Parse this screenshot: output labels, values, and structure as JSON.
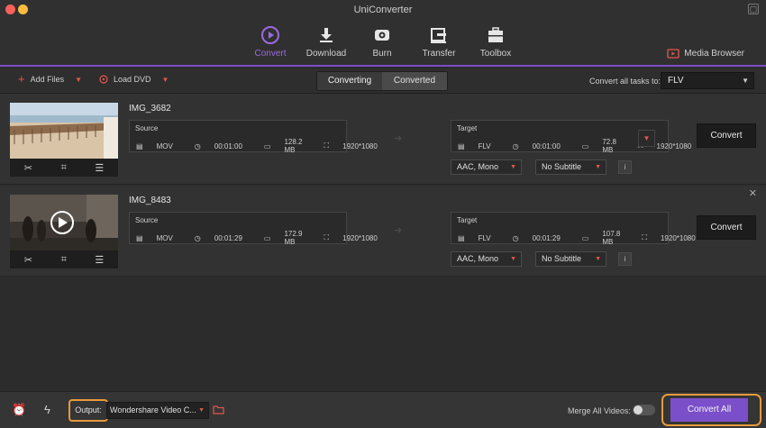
{
  "window": {
    "title": "UniConverter"
  },
  "nav": {
    "items": [
      {
        "label": "Convert",
        "icon": "convert-play-icon",
        "active": true
      },
      {
        "label": "Download",
        "icon": "download-icon",
        "active": false
      },
      {
        "label": "Burn",
        "icon": "disc-icon",
        "active": false
      },
      {
        "label": "Transfer",
        "icon": "transfer-icon",
        "active": false
      },
      {
        "label": "Toolbox",
        "icon": "toolbox-icon",
        "active": false
      }
    ],
    "media_browser": "Media Browser"
  },
  "toolbar": {
    "add_files": "Add Files",
    "load_dvd": "Load DVD",
    "tabs": [
      "Converting",
      "Converted"
    ],
    "active_tab": "Converting",
    "convert_all_label": "Convert all tasks to:",
    "convert_all_format": "FLV"
  },
  "tasks": [
    {
      "name": "IMG_3682",
      "source": {
        "caption": "Source",
        "format": "MOV",
        "duration": "00:01:00",
        "size": "128.2 MB",
        "resolution": "1920*1080"
      },
      "target": {
        "caption": "Target",
        "format": "FLV",
        "duration": "00:01:00",
        "size": "72.8 MB",
        "resolution": "1920*1080"
      },
      "audio": "AAC, Mono",
      "subtitle": "No Subtitle",
      "convert_label": "Convert"
    },
    {
      "name": "IMG_8483",
      "source": {
        "caption": "Source",
        "format": "MOV",
        "duration": "00:01:29",
        "size": "172.9 MB",
        "resolution": "1920*1080"
      },
      "target": {
        "caption": "Target",
        "format": "FLV",
        "duration": "00:01:29",
        "size": "107.8 MB",
        "resolution": "1920*1080"
      },
      "audio": "AAC, Mono",
      "subtitle": "No Subtitle",
      "convert_label": "Convert"
    }
  ],
  "bottom": {
    "output_label": "Output:",
    "output_path": "Wondershare Video C...",
    "merge_label": "Merge All Videos:",
    "merge_on": false,
    "convert_all": "Convert All"
  },
  "colors": {
    "accent": "#7b4fc9",
    "highlight": "#e89a3c",
    "caret": "#e2574c"
  }
}
